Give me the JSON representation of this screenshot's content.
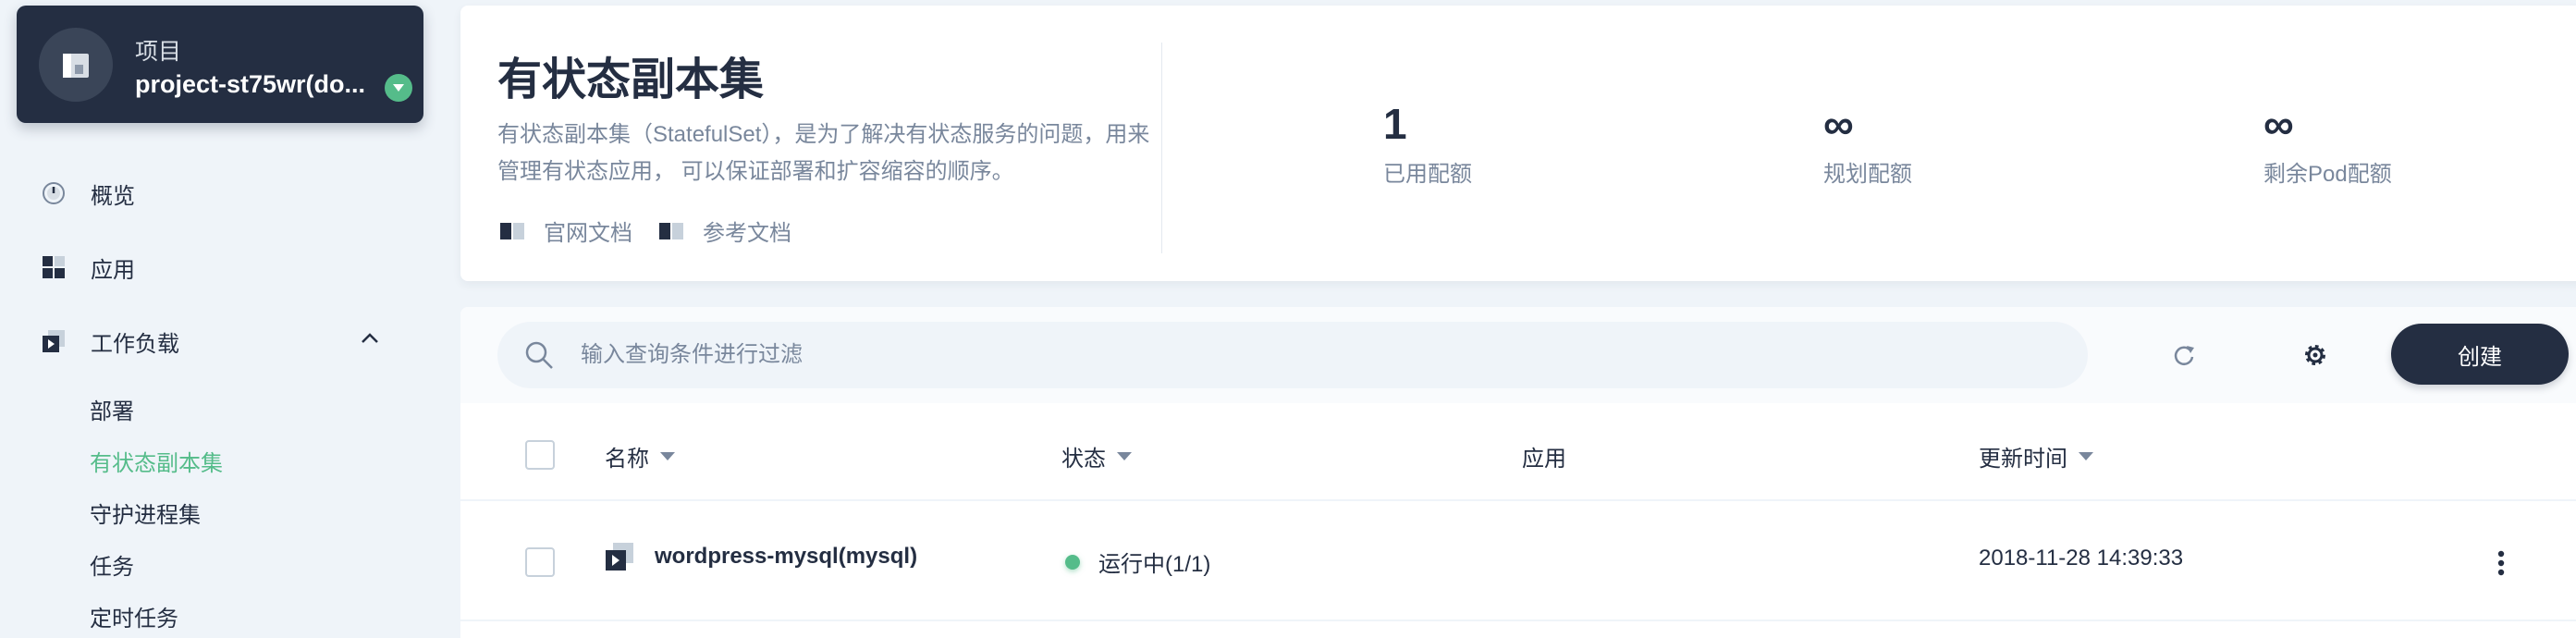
{
  "project": {
    "label": "项目",
    "name": "project-st75wr(do..."
  },
  "nav": {
    "overview": "概览",
    "apps": "应用",
    "workloads": "工作负载",
    "sub_items": [
      "部署",
      "有状态副本集",
      "守护进程集",
      "任务",
      "定时任务"
    ],
    "active_sub_item": "有状态副本集"
  },
  "header": {
    "title": "有状态副本集",
    "description": "有状态副本集（StatefulSet），是为了解决有状态服务的问题，用来管理有状态应用， 可以保证部署和扩容缩容的顺序。",
    "doc_official": "官网文档",
    "doc_reference": "参考文档"
  },
  "quota": [
    {
      "value": "1",
      "label": "已用配额"
    },
    {
      "value": "∞",
      "label": "规划配额"
    },
    {
      "value": "∞",
      "label": "剩余Pod配额"
    }
  ],
  "toolbar": {
    "search_placeholder": "输入查询条件进行过滤",
    "create_label": "创建"
  },
  "table": {
    "columns": [
      "名称",
      "状态",
      "应用",
      "更新时间"
    ],
    "rows": [
      {
        "name": "wordpress-mysql(mysql)",
        "status": "运行中(1/1)",
        "app": "",
        "updated": "2018-11-28 14:39:33"
      }
    ]
  },
  "colors": {
    "accent": "#55bc8a",
    "dark": "#242e42",
    "muted": "#79879c",
    "background": "#eff4f9"
  },
  "icons": {
    "project": "project-icon",
    "overview": "dashboard-icon",
    "apps": "apps-icon",
    "workloads": "workload-icon",
    "search": "search-icon",
    "refresh": "refresh-icon",
    "settings": "gear-icon",
    "more": "more-vertical-icon"
  }
}
